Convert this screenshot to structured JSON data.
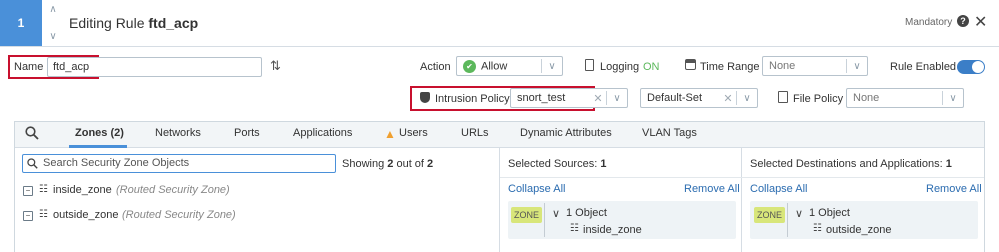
{
  "header": {
    "rule_number": "1",
    "title_prefix": "Editing Rule",
    "rule_name": "ftd_acp",
    "mandatory_label": "Mandatory",
    "help_icon": "question-circle-icon",
    "close_icon": "close-icon"
  },
  "rule": {
    "name_label": "Name",
    "name_value": "ftd_acp",
    "action_label": "Action",
    "action_value": "Allow",
    "logging_label": "Logging",
    "logging_value": "ON",
    "time_range_label": "Time Range",
    "time_range_value": "None",
    "rule_enabled_label": "Rule Enabled",
    "intrusion_policy_label": "Intrusion Policy",
    "intrusion_policy_value": "snort_test",
    "variable_set_value": "Default-Set",
    "file_policy_label": "File Policy",
    "file_policy_value": "None"
  },
  "tabs": [
    {
      "label": "Zones (2)",
      "active": true
    },
    {
      "label": "Networks"
    },
    {
      "label": "Ports"
    },
    {
      "label": "Applications"
    },
    {
      "label": "Users",
      "icon": "warning-icon"
    },
    {
      "label": "URLs"
    },
    {
      "label": "Dynamic Attributes"
    },
    {
      "label": "VLAN Tags"
    }
  ],
  "zones": {
    "search_placeholder": "Search Security Zone Objects",
    "showing_prefix": "Showing",
    "showing_count": "2",
    "showing_middle": "out of",
    "showing_total": "2",
    "items": [
      {
        "name": "inside_zone",
        "type": "(Routed Security Zone)"
      },
      {
        "name": "outside_zone",
        "type": "(Routed Security Zone)"
      }
    ]
  },
  "sources": {
    "label": "Selected Sources:",
    "count": "1",
    "collapse_all": "Collapse All",
    "remove_all": "Remove All",
    "tag": "ZONE",
    "group_label": "1 Object",
    "object": "inside_zone"
  },
  "destinations": {
    "label": "Selected Destinations and Applications:",
    "count": "1",
    "collapse_all": "Collapse All",
    "remove_all": "Remove All",
    "tag": "ZONE",
    "group_label": "1 Object",
    "object": "outside_zone"
  },
  "colors": {
    "accent": "#4a90d9",
    "highlight_border": "#c8102e",
    "logging_on": "#5cb85c",
    "zone_tag": "#d8e67a"
  }
}
